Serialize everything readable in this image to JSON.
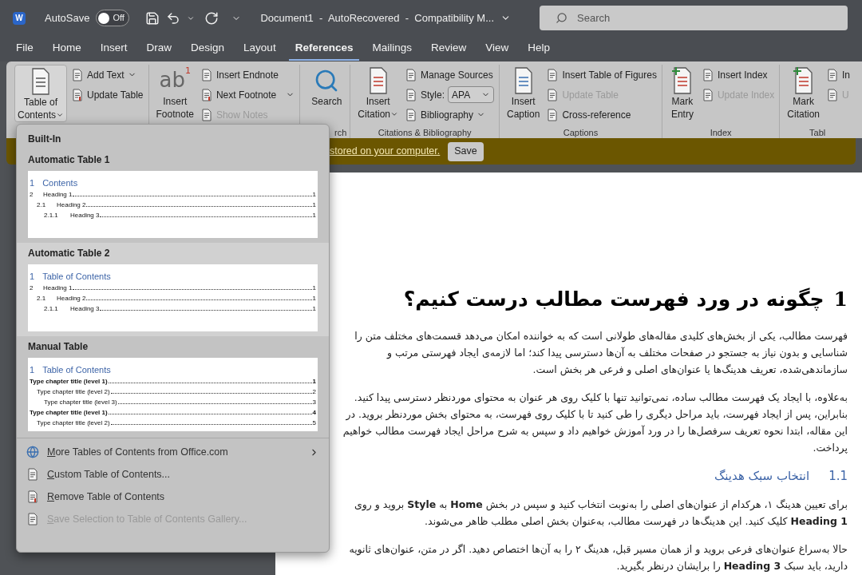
{
  "title_bar": {
    "logo_letter": "W",
    "autosave_label": "AutoSave",
    "autosave_toggle": {
      "on": false,
      "label": "Off"
    },
    "document_title": "Document1  -  AutoRecovered  -  Compatibility M...",
    "search_placeholder": "Search"
  },
  "menu_tabs": [
    {
      "label": "File",
      "selected": false
    },
    {
      "label": "Home",
      "selected": false
    },
    {
      "label": "Insert",
      "selected": false
    },
    {
      "label": "Draw",
      "selected": false
    },
    {
      "label": "Design",
      "selected": false
    },
    {
      "label": "Layout",
      "selected": false
    },
    {
      "label": "References",
      "selected": true
    },
    {
      "label": "Mailings",
      "selected": false
    },
    {
      "label": "Review",
      "selected": false
    },
    {
      "label": "View",
      "selected": false
    },
    {
      "label": "Help",
      "selected": false
    }
  ],
  "ribbon": {
    "groups": [
      {
        "items": [
          {
            "kind": "large",
            "lines": [
              "Table of",
              "Contents"
            ],
            "caret": true,
            "pressed": true
          },
          {
            "kind": "stack",
            "items": [
              {
                "kind": "small",
                "label": "Add Text",
                "caret": true,
                "disabled": false
              },
              {
                "kind": "small",
                "label": "Update Table",
                "caret": false,
                "disabled": false
              }
            ]
          }
        ]
      },
      {
        "items": [
          {
            "kind": "large",
            "icon_text": "ab",
            "icon_sup": "1",
            "lines": [
              "Insert",
              "Footnote"
            ],
            "caret": false,
            "pressed": false
          },
          {
            "kind": "stack",
            "items": [
              {
                "kind": "small",
                "label": "Insert Endnote",
                "caret": false,
                "disabled": false
              },
              {
                "kind": "small",
                "label": "Next Footnote",
                "caret": true,
                "disabled": false
              },
              {
                "kind": "small",
                "label": "Show Notes",
                "caret": false,
                "disabled": true
              }
            ]
          }
        ]
      },
      {
        "label": "rch",
        "items": [
          {
            "kind": "large",
            "lines": [
              "Search"
            ],
            "caret": false,
            "pressed": false
          }
        ]
      },
      {
        "label": "Citations & Bibliography",
        "items": [
          {
            "kind": "large",
            "lines": [
              "Insert",
              "Citation"
            ],
            "caret": true,
            "pressed": false
          },
          {
            "kind": "stack",
            "items": [
              {
                "kind": "small",
                "label": "Manage Sources",
                "caret": false,
                "disabled": false
              },
              {
                "kind": "select",
                "label": "Style:",
                "value": "APA"
              },
              {
                "kind": "small",
                "label": "Bibliography",
                "caret": true,
                "disabled": false
              }
            ]
          }
        ]
      },
      {
        "label": "Captions",
        "items": [
          {
            "kind": "large",
            "lines": [
              "Insert",
              "Caption"
            ],
            "caret": false,
            "pressed": false
          },
          {
            "kind": "stack",
            "items": [
              {
                "kind": "small",
                "label": "Insert Table of Figures",
                "caret": false,
                "disabled": false
              },
              {
                "kind": "small",
                "label": "Update Table",
                "caret": false,
                "disabled": true
              },
              {
                "kind": "small",
                "label": "Cross-reference",
                "caret": false,
                "disabled": false
              }
            ]
          }
        ]
      },
      {
        "label": "Index",
        "items": [
          {
            "kind": "large",
            "lines": [
              "Mark",
              "Entry"
            ],
            "caret": false,
            "pressed": false
          },
          {
            "kind": "stack",
            "items": [
              {
                "kind": "small",
                "label": "Insert Index",
                "caret": false,
                "disabled": false
              },
              {
                "kind": "small",
                "label": "Update Index",
                "caret": false,
                "disabled": true
              }
            ]
          }
        ]
      },
      {
        "label": "Tabl",
        "items": [
          {
            "kind": "large",
            "lines": [
              "Mark",
              "Citation"
            ],
            "caret": false,
            "pressed": false
          },
          {
            "kind": "stack",
            "items": [
              {
                "kind": "small",
                "label": "In",
                "caret": false,
                "disabled": false
              },
              {
                "kind": "small",
                "label": "U",
                "caret": false,
                "disabled": true
              }
            ]
          }
        ]
      }
    ]
  },
  "message_bar": {
    "link": "stored on your computer.",
    "button": "Save"
  },
  "toc_menu": {
    "section_title": "Built-In",
    "gallery": [
      {
        "title": "Automatic Table 1",
        "selected": false,
        "preview": {
          "number": "1",
          "heading": "Contents",
          "entries": [
            {
              "number": "2",
              "text": "Heading 1",
              "page": "1",
              "children": [
                {
                  "number": "2.1",
                  "text": "Heading 2",
                  "page": "1",
                  "children": [
                    {
                      "number": "2.1.1",
                      "text": "Heading 3",
                      "page": "1"
                    }
                  ]
                }
              ]
            }
          ]
        }
      },
      {
        "title": "Automatic Table 2",
        "selected": true,
        "preview": {
          "number": "1",
          "heading": "Table of Contents",
          "entries": [
            {
              "number": "2",
              "text": "Heading 1",
              "page": "1",
              "children": [
                {
                  "number": "2.1",
                  "text": "Heading 2",
                  "page": "1",
                  "children": [
                    {
                      "number": "2.1.1",
                      "text": "Heading 3",
                      "page": "1"
                    }
                  ]
                }
              ]
            }
          ]
        }
      },
      {
        "title": "Manual Table",
        "selected": false,
        "preview": {
          "number": "1",
          "heading": "Table of Contents",
          "entries": [
            {
              "text": "Type chapter title (level 1)",
              "page": "1",
              "children": [
                {
                  "text": "Type chapter title (level 2)",
                  "page": "2",
                  "children": [
                    {
                      "text": "Type chapter title (level 3)",
                      "page": "3"
                    }
                  ]
                }
              ]
            },
            {
              "text": "Type chapter title (level 1)",
              "page": "4",
              "children": [
                {
                  "text": "Type chapter title (level 2)",
                  "page": "5"
                }
              ]
            }
          ]
        }
      }
    ],
    "items": [
      {
        "label": "More Tables of Contents from Office.com",
        "submenu": true,
        "disabled": false
      },
      {
        "label": "Custom Table of Contents...",
        "submenu": false,
        "disabled": false
      },
      {
        "label": "Remove Table of Contents",
        "submenu": false,
        "disabled": false
      },
      {
        "label": "Save Selection to Table of Contents Gallery...",
        "submenu": false,
        "disabled": true
      }
    ]
  },
  "document": {
    "heading": {
      "number": "1",
      "text": "چگونه در ورد فهرست مطالب درست کنیم؟"
    },
    "blocks": [
      {
        "kind": "paragraph",
        "text": "فهرست مطالب، یکی از بخش‌های کلیدی مقاله‌های طولانی است که به خواننده امکان می‌دهد قسمت‌های مختلف متن را شناسایی و بدون نیاز به جستجو در صفحات مختلف به آن‌ها دسترسی پیدا کند؛ اما لازمه‌ی ایجاد فهرستی مرتب و سازماندهی‌شده، تعریف هدینگ‌ها یا عنوان‌های اصلی و فرعی هر بخش است."
      },
      {
        "kind": "paragraph",
        "text": "به‌علاوه، با ایجاد یک فهرست مطالب ساده، نمی‌توانید تنها با کلیک روی هر عنوان به محتوای موردنظر دسترسی پیدا کنید. بنابراین، پس از ایجاد فهرست، باید مراحل دیگری را طی کنید تا با کلیک روی فهرست، به محتوای بخش موردنظر بروید. در این مقاله، ابتدا نحوه تعریف سرفصل‌ها را در ورد آموزش خواهیم داد و سپس به شرح مراحل ایجاد فهرست مطالب خواهیم پرداخت."
      },
      {
        "kind": "subheading",
        "number": "1.1",
        "text": "انتخاب سبک هدینگ"
      },
      {
        "kind": "paragraph",
        "text": "برای تعیین هدینگ ۱، هرکدام از عنوان‌های اصلی را به‌نوبت انتخاب کنید و سپس در بخش **Home** به **Style** بروید و روی **Heading 1** کلیک کنید. این هدینگ‌ها در فهرست مطالب، به‌عنوان بخش اصلی مطلب ظاهر می‌شوند."
      },
      {
        "kind": "paragraph",
        "text": "حالا به‌سراغ عنوان‌های فرعی بروید و از همان مسیر قبل، هدینگ ۲ را به آن‌ها اختصاص دهید. اگر در متن، عنوان‌های ثانویه دارید، باید سبک **Heading 3** را برایشان درنظر بگیرید."
      }
    ]
  }
}
